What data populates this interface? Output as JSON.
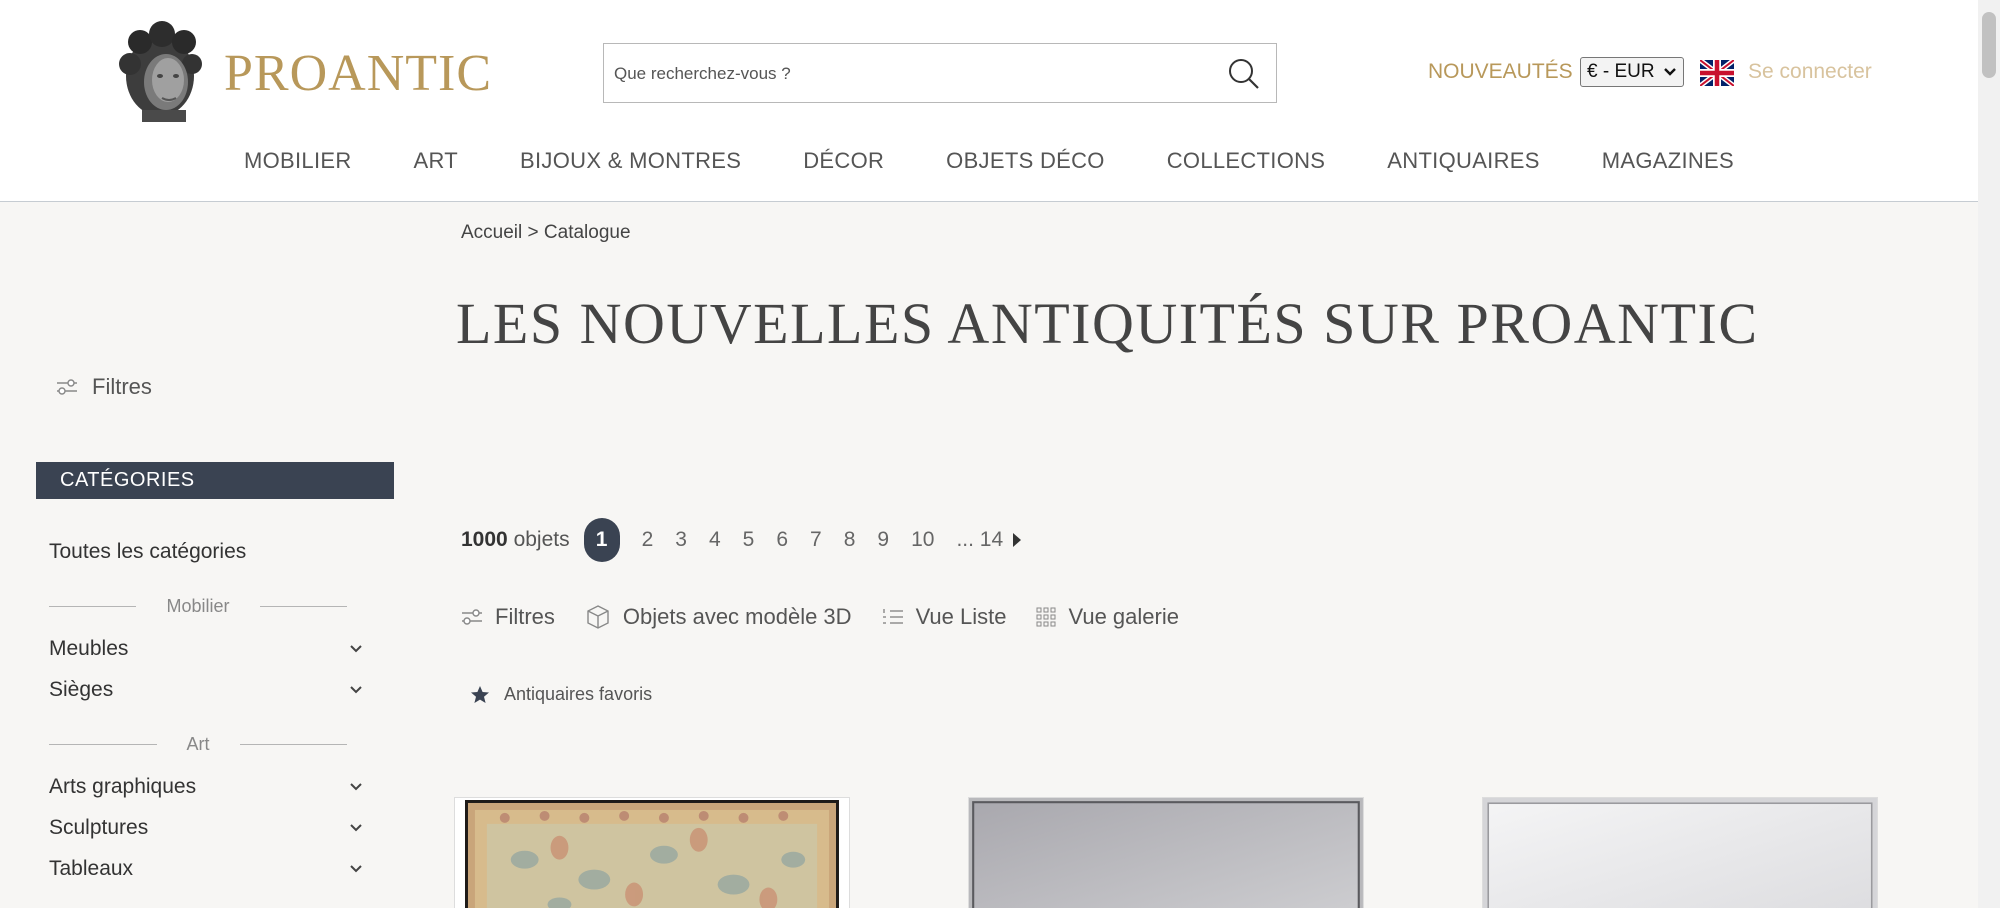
{
  "header": {
    "logo_text": "PROANTIC",
    "search_placeholder": "Que recherchez-vous ?",
    "nouveautes": "NOUVEAUTÉS",
    "currency": "€ - EUR",
    "login": "Se connecter"
  },
  "nav": [
    "MOBILIER",
    "ART",
    "BIJOUX & MONTRES",
    "DÉCOR",
    "OBJETS DÉCO",
    "COLLECTIONS",
    "ANTIQUAIRES",
    "MAGAZINES"
  ],
  "sidebar": {
    "filters_label": "Filtres",
    "categories_header": "CATÉGORIES",
    "all_categories": "Toutes les catégories",
    "group_mobilier": "Mobilier",
    "mobilier_items": [
      "Meubles",
      "Sièges"
    ],
    "group_art": "Art",
    "art_items": [
      "Arts graphiques",
      "Sculptures",
      "Tableaux"
    ]
  },
  "main": {
    "breadcrumb": "Accueil > Catalogue",
    "title": "LES NOUVELLES ANTIQUITÉS SUR PROANTIC",
    "count_number": "1000",
    "count_label": "objets",
    "pages": [
      "1",
      "2",
      "3",
      "4",
      "5",
      "6",
      "7",
      "8",
      "9",
      "10",
      "... 14"
    ],
    "current_page": "1",
    "toolbar": {
      "filters": "Filtres",
      "objects_3d": "Objets avec modèle 3D",
      "list_view": "Vue Liste",
      "gallery_view": "Vue galerie"
    },
    "favorites": "Antiquaires favoris"
  },
  "colors": {
    "brand_gold": "#b8985a",
    "dark_navy": "#3a4352",
    "background": "#f7f6f4"
  }
}
